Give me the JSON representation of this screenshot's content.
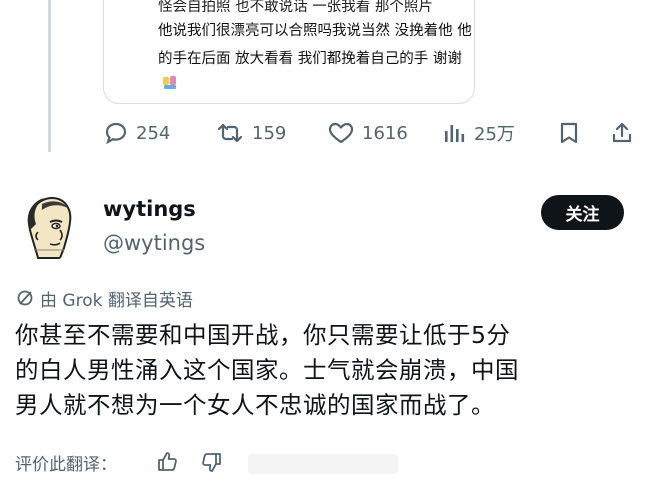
{
  "quoted_post": {
    "line_top": "怪会自拍照 也不敢说话 一张我看 那个照片",
    "line_2": "他说我们很漂亮可以合照吗我说当然 没挽着他 他",
    "line_3": "的手在后面 放大看看 我们都挽着自己的手 谢谢"
  },
  "actions": {
    "replies": "254",
    "reposts": "159",
    "likes": "1616",
    "views": "25万"
  },
  "post": {
    "username": "wytings",
    "handle": "@wytings",
    "follow_label": "关注",
    "translated_label": "由 Grok 翻译自英语",
    "text_lines": [
      "你甚至不需要和中国开战，你只需要让低于5分",
      "的白人男性涌入这个国家。士气就会崩溃，中国",
      "男人就不想为一个女人不忠诚的国家而战了。"
    ],
    "rate_label": "评价此翻译："
  },
  "colors": {
    "text": "#0f1419",
    "secondary": "#536471",
    "button_bg": "#0f1419"
  },
  "icons": [
    "reply-icon",
    "repost-icon",
    "like-icon",
    "views-icon",
    "bookmark-icon",
    "share-icon",
    "grok-icon",
    "thumbs-up-icon",
    "thumbs-down-icon"
  ]
}
